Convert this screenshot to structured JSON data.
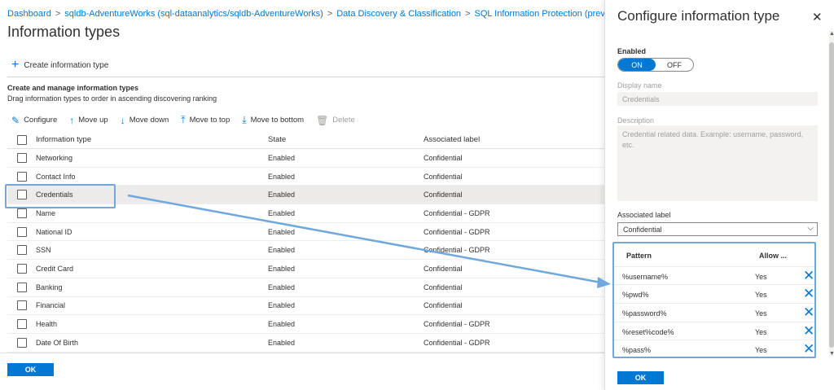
{
  "breadcrumb": {
    "items": [
      "Dashboard",
      "sqldb-AdventureWorks (sql-dataanalytics/sqldb-AdventureWorks)",
      "Data Discovery & Classification",
      "SQL Information Protection (preview)"
    ],
    "separator": ">"
  },
  "page": {
    "title": "Information types",
    "create_label": "Create information type",
    "section_title": "Create and manage information types",
    "section_subtitle": "Drag information types to order in ascending discovering ranking"
  },
  "toolbar": {
    "configure": "Configure",
    "move_up": "Move up",
    "move_down": "Move down",
    "move_to_top": "Move to top",
    "move_to_bottom": "Move to bottom",
    "delete": "Delete"
  },
  "grid": {
    "headers": [
      "Information type",
      "State",
      "Associated label"
    ],
    "rows": [
      {
        "name": "Networking",
        "state": "Enabled",
        "label": "Confidential"
      },
      {
        "name": "Contact Info",
        "state": "Enabled",
        "label": "Confidential"
      },
      {
        "name": "Credentials",
        "state": "Enabled",
        "label": "Confidential"
      },
      {
        "name": "Name",
        "state": "Enabled",
        "label": "Confidential - GDPR"
      },
      {
        "name": "National ID",
        "state": "Enabled",
        "label": "Confidential - GDPR"
      },
      {
        "name": "SSN",
        "state": "Enabled",
        "label": "Confidential - GDPR"
      },
      {
        "name": "Credit Card",
        "state": "Enabled",
        "label": "Confidential"
      },
      {
        "name": "Banking",
        "state": "Enabled",
        "label": "Confidential"
      },
      {
        "name": "Financial",
        "state": "Enabled",
        "label": "Confidential"
      },
      {
        "name": "Health",
        "state": "Enabled",
        "label": "Confidential - GDPR"
      },
      {
        "name": "Date Of Birth",
        "state": "Enabled",
        "label": "Confidential - GDPR"
      }
    ]
  },
  "main_footer": {
    "ok_label": "OK"
  },
  "panel": {
    "title": "Configure information type",
    "close_icon": "close-icon",
    "enabled_label": "Enabled",
    "toggle_on": "ON",
    "toggle_off": "OFF",
    "display_name_label": "Display name",
    "display_name_value": "Credentials",
    "description_label": "Description",
    "description_value": "Credential related data. Example: username, password, etc.",
    "associated_label_label": "Associated label",
    "associated_label_value": "Confidential",
    "pattern_header": "Pattern",
    "allow_header": "Allow ...",
    "patterns": [
      {
        "pattern": "%username%",
        "allow": "Yes"
      },
      {
        "pattern": "%pwd%",
        "allow": "Yes"
      },
      {
        "pattern": "%password%",
        "allow": "Yes"
      },
      {
        "pattern": "%reset%code%",
        "allow": "Yes"
      },
      {
        "pattern": "%pass%",
        "allow": "Yes"
      }
    ],
    "ok_label": "OK"
  },
  "colors": {
    "accent": "#0078d4",
    "annotation": "#6fa8dc",
    "selected_row": "#edebe9"
  }
}
